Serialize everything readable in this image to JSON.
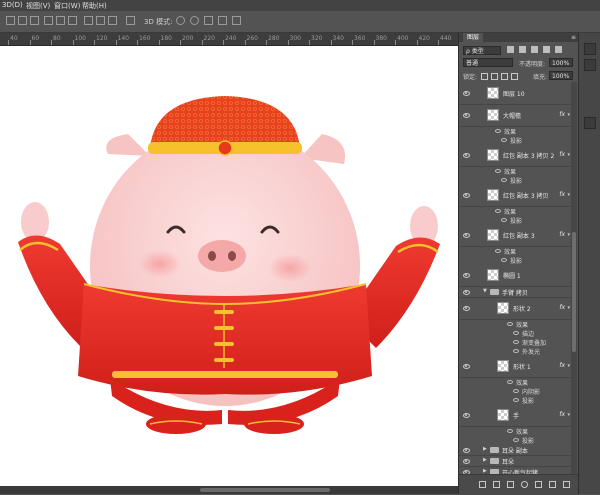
{
  "menu": [
    {
      "label": "3D(D)"
    },
    {
      "label": "视图(V)"
    },
    {
      "label": "窗口(W)"
    },
    {
      "label": "帮助(H)"
    }
  ],
  "options_bar": {
    "mode_label": "3D 模式:"
  },
  "ruler": {
    "ticks": [
      "40",
      "60",
      "80",
      "100",
      "120",
      "140",
      "160",
      "180",
      "200",
      "220",
      "240",
      "260",
      "280",
      "300",
      "320",
      "340",
      "360",
      "380",
      "400",
      "420",
      "440"
    ]
  },
  "panel": {
    "tab": "图层",
    "menu_glyph": "≡",
    "filter_kind": "ρ 类型",
    "blend_mode": "普通",
    "opacity_label": "不透明度:",
    "opacity_value": "100%",
    "lock_label": "锁定:",
    "fill_label": "填充:",
    "fill_value": "100%"
  },
  "layers": [
    {
      "kind": "layer",
      "name": "图层 10",
      "fx": false
    },
    {
      "kind": "layer",
      "name": "大帽檐",
      "fx": true
    },
    {
      "kind": "sub",
      "label": "效果",
      "indent": 1
    },
    {
      "kind": "sub",
      "label": "投影",
      "indent": 2
    },
    {
      "kind": "layer",
      "name": "红包 副本 3 拷贝 2",
      "fx": true
    },
    {
      "kind": "sub",
      "label": "效果",
      "indent": 1
    },
    {
      "kind": "sub",
      "label": "投影",
      "indent": 2
    },
    {
      "kind": "layer",
      "name": "红包 副本 3 拷贝",
      "fx": true
    },
    {
      "kind": "sub",
      "label": "效果",
      "indent": 1
    },
    {
      "kind": "sub",
      "label": "投影",
      "indent": 2
    },
    {
      "kind": "layer",
      "name": "红包 副本 3",
      "fx": true
    },
    {
      "kind": "sub",
      "label": "效果",
      "indent": 1
    },
    {
      "kind": "sub",
      "label": "投影",
      "indent": 2
    },
    {
      "kind": "layer",
      "name": "椭圆 1",
      "fx": false
    },
    {
      "kind": "group",
      "name": "手臂 拷贝",
      "open": true
    },
    {
      "kind": "layer",
      "name": "形状 2",
      "fx": true,
      "nested": true
    },
    {
      "kind": "sub",
      "label": "效果",
      "indent": 3
    },
    {
      "kind": "sub",
      "label": "描边",
      "indent": 4
    },
    {
      "kind": "sub",
      "label": "渐变叠加",
      "indent": 4
    },
    {
      "kind": "sub",
      "label": "外发光",
      "indent": 4
    },
    {
      "kind": "layer",
      "name": "形状 1",
      "fx": true,
      "nested": true
    },
    {
      "kind": "sub",
      "label": "效果",
      "indent": 3
    },
    {
      "kind": "sub",
      "label": "内阴影",
      "indent": 4
    },
    {
      "kind": "sub",
      "label": "投影",
      "indent": 4
    },
    {
      "kind": "layer",
      "name": "手",
      "fx": true,
      "nested": true
    },
    {
      "kind": "sub",
      "label": "效果",
      "indent": 3
    },
    {
      "kind": "sub",
      "label": "投影",
      "indent": 4
    },
    {
      "kind": "group",
      "name": "耳朵 副本",
      "open": false
    },
    {
      "kind": "group",
      "name": "耳朵",
      "open": false
    },
    {
      "kind": "group",
      "name": "开心新气起猪",
      "open": false
    },
    {
      "kind": "group",
      "name": "拜年猪超级开心",
      "open": false
    },
    {
      "kind": "group",
      "name": "拜年猪",
      "open": false
    },
    {
      "kind": "background",
      "name": "背景"
    }
  ],
  "colors": {
    "ui_dark": "#535353",
    "canvas": "#ffffff",
    "pig_skin": "#fcd6d6",
    "suit_red": "#e42a24",
    "hat_red": "#e63b1c",
    "gold": "#f5c12c",
    "snout": "#f4a8a8"
  },
  "icons": {
    "eye": "eye-icon",
    "fx": "fx-icon",
    "folder": "folder-icon",
    "lock": "lock-icon",
    "link": "link-icon",
    "trash": "trash-icon"
  }
}
